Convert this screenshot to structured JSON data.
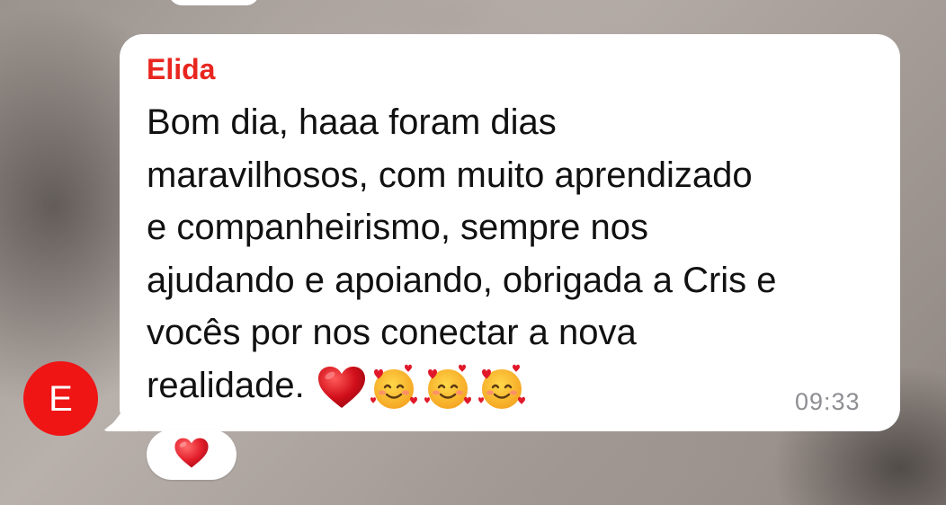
{
  "message": {
    "sender": "Elida",
    "lines": [
      "Bom dia, haaa foram dias",
      "maravilhosos, com muito aprendizado",
      "e companheirismo, sempre nos",
      "ajudando e apoiando, obrigada a Cris e",
      "vocês por nos conectar a  nova",
      "realidade."
    ],
    "emojis": [
      "red-heart",
      "smiling-face-with-hearts",
      "smiling-face-with-hearts",
      "smiling-face-with-hearts"
    ],
    "time": "09:33",
    "avatar_initial": "E",
    "reaction": "red-heart"
  },
  "colors": {
    "sender_name": "#e8261f",
    "avatar": "#ef1515",
    "bubble": "#ffffff",
    "timestamp": "#8e8e93"
  }
}
